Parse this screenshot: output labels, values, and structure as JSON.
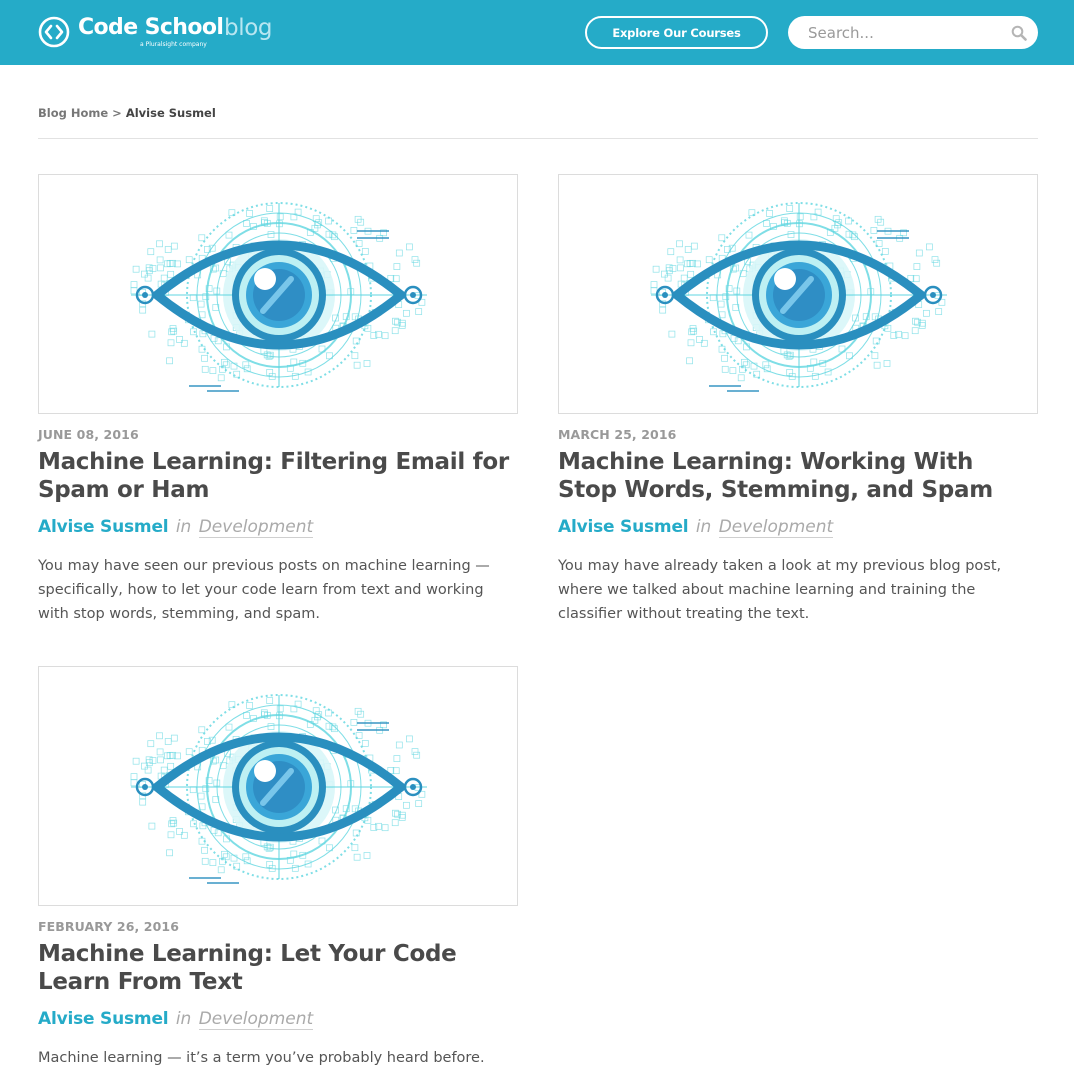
{
  "header": {
    "logo_name": "Code School",
    "logo_suffix": "blog",
    "logo_tag": "a Pluralsight company",
    "explore_label": "Explore Our Courses",
    "search_placeholder": "Search..."
  },
  "breadcrumb": {
    "home": "Blog Home",
    "separator": ">",
    "current": "Alvise Susmel"
  },
  "posts": [
    {
      "date": "JUNE 08, 2016",
      "title": "Machine Learning: Filtering Email for Spam or Ham",
      "author": "Alvise Susmel",
      "in": "in",
      "category": "Development",
      "excerpt": "You may have seen our previous posts on machine learning — specifically, how to let your code learn from text and working with stop words, stemming, and spam."
    },
    {
      "date": "MARCH 25, 2016",
      "title": "Machine Learning: Working With Stop Words, Stemming, and Spam",
      "author": "Alvise Susmel",
      "in": "in",
      "category": "Development",
      "excerpt": "You may have already taken a look at my previous blog post, where we talked about machine learning and training the classifier without treating the text."
    },
    {
      "date": "FEBRUARY 26, 2016",
      "title": "Machine Learning: Let Your Code Learn From Text",
      "author": "Alvise Susmel",
      "in": "in",
      "category": "Development",
      "excerpt": "Machine learning — it’s a term you’ve probably heard before."
    }
  ],
  "colors": {
    "brand": "#25abc8",
    "eye_dark": "#2a8fbf",
    "eye_light": "#5fd6e0"
  }
}
